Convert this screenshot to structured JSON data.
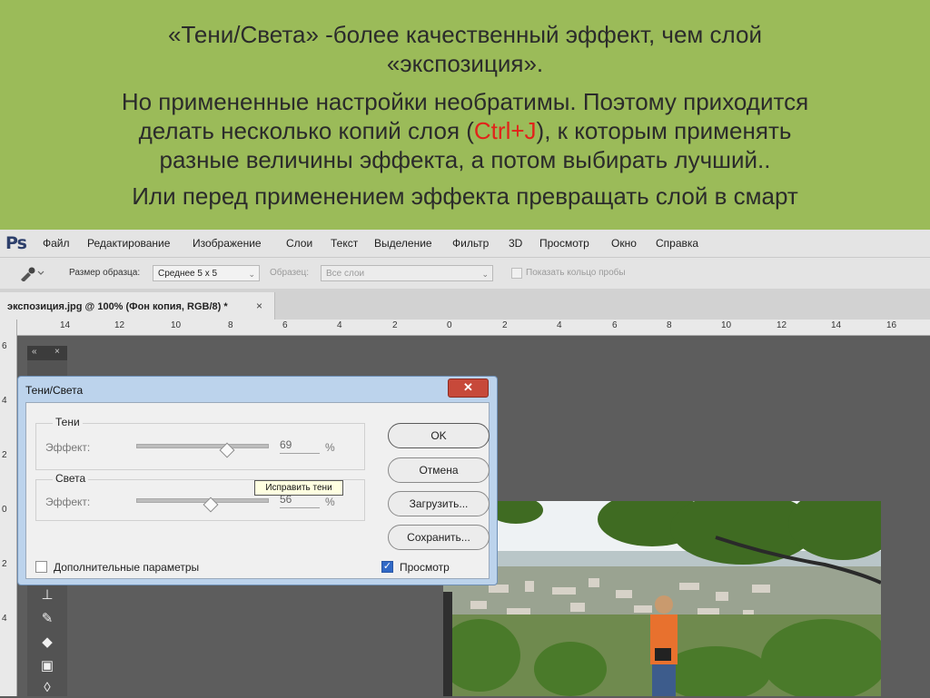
{
  "slide": {
    "line1": "«Тени/Света» -более качественный эффект, чем слой",
    "line2": "«экспозиция».",
    "line3": "Но примененные настройки необратимы. Поэтому приходится",
    "line4_before": "делать несколько копий слоя (",
    "line4_hotkey": "Ctrl+J",
    "line4_after": "), к которым применять",
    "line5": "разные величины эффекта, а потом выбирать лучший..",
    "line6": "Или перед применением эффекта превращать слой в смарт",
    "accent_color": "#e2231a",
    "background_color": "#9bbb59"
  },
  "app": {
    "logo": "Ps",
    "menu": [
      "Файл",
      "Редактирование",
      "Изображение",
      "Слои",
      "Текст",
      "Выделение",
      "Фильтр",
      "3D",
      "Просмотр",
      "Окно",
      "Справка"
    ]
  },
  "options": {
    "sample_size_label": "Размер образца:",
    "sample_size_value": "Среднее 5 x 5",
    "sample_label": "Образец:",
    "sample_value": "Все слои",
    "show_ring_label": "Показать кольцо пробы"
  },
  "document": {
    "tab_title": "экспозиция.jpg @ 100% (Фон копия, RGB/8) *",
    "close_glyph": "×"
  },
  "ruler": {
    "h_labels": [
      "14",
      "12",
      "10",
      "8",
      "6",
      "4",
      "2",
      "0",
      "2",
      "4",
      "6",
      "8",
      "10",
      "12",
      "14",
      "16"
    ],
    "v_labels": [
      "6",
      "4",
      "2",
      "0",
      "2",
      "4"
    ]
  },
  "dialog": {
    "title": "Тени/Света",
    "close_glyph": "✕",
    "shadows_group": "Тени",
    "shadows_effect_label": "Эффект:",
    "shadows_value": "69",
    "shadows_unit": "%",
    "shadows_fraction": 0.69,
    "highlights_group": "Света",
    "highlights_effect_label": "Эффект:",
    "highlights_value": "56",
    "highlights_unit": "%",
    "highlights_fraction": 0.56,
    "tooltip": "Исправить тени",
    "more_options_label": "Дополнительные параметры",
    "more_options_checked": false,
    "preview_label": "Просмотр",
    "preview_checked": true,
    "buttons": {
      "ok": "OK",
      "cancel": "Отмена",
      "load": "Загрузить...",
      "save": "Сохранить..."
    }
  },
  "tools_panel": {
    "collapse_glyph": "«",
    "close_glyph": "×"
  }
}
